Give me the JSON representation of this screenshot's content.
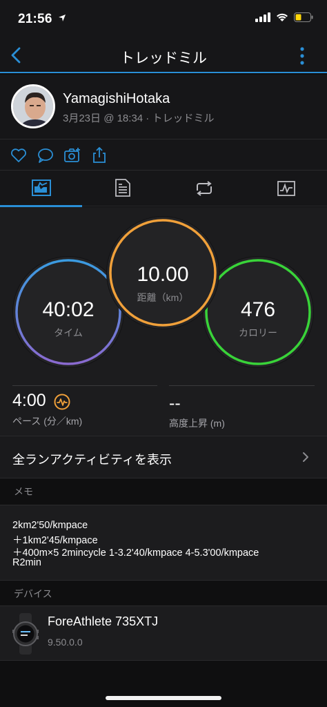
{
  "status_bar": {
    "time": "21:56"
  },
  "nav": {
    "title": "トレッドミル"
  },
  "profile": {
    "name": "YamagishiHotaka",
    "meta": "3月23日 @ 18:34 · トレッドミル"
  },
  "stats": {
    "time": {
      "value": "40:02",
      "label": "タイム"
    },
    "distance": {
      "value": "10.00",
      "label": "距離（km）"
    },
    "calories": {
      "value": "476",
      "label": "カロリー"
    },
    "pace": {
      "value": "4:00",
      "label": "ペース (分／km)"
    },
    "elevation": {
      "value": "--",
      "label": "高度上昇 (m)"
    }
  },
  "all_runs": {
    "label": "全ランアクティビティを表示"
  },
  "memo": {
    "header": "メモ",
    "lines": [
      "2km2'50/kmpace",
      "＋1km2'45/kmpace",
      "＋400m×5 2mincycle 1-3.2'40/kmpace 4-5.3'00/kmpace",
      "R2min"
    ]
  },
  "device": {
    "header": "デバイス",
    "name": "ForeAthlete 735XTJ",
    "version": "9.50.0.0"
  },
  "colors": {
    "accent": "#2a8fd6",
    "time_ring": "#6a7fd0",
    "distance_ring": "#f0a03a",
    "calories_ring": "#3ad43a"
  }
}
